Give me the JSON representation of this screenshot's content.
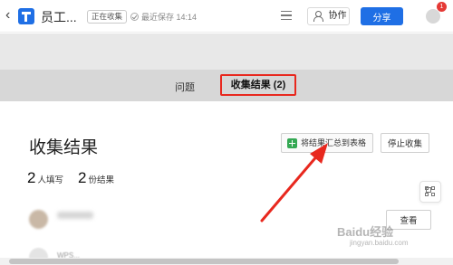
{
  "header": {
    "back_glyph": "‹",
    "doc_title": "员工...",
    "status_badge": "正在收集",
    "save_status": "最近保存 14:14",
    "collab_label": "协作",
    "share_label": "分享",
    "notification_count": "1"
  },
  "tabs": [
    {
      "label": "问题"
    },
    {
      "label": "收集结果 (2)"
    }
  ],
  "main": {
    "title": "收集结果",
    "summarize_label": "将结果汇总到表格",
    "stop_label": "停止收集",
    "stats": {
      "filled_count": "2",
      "filled_label": "人填写",
      "results_count": "2",
      "results_label": "份结果"
    },
    "rows": [
      {
        "action_label": "查看"
      },
      {
        "name_partial": "WPS..."
      }
    ]
  },
  "watermark": {
    "text": "Baidu经验",
    "sub": "jingyan.baidu.com"
  },
  "colors": {
    "accent": "#1f6fe5",
    "highlight": "#e8281e",
    "sheet_green": "#34a853"
  }
}
